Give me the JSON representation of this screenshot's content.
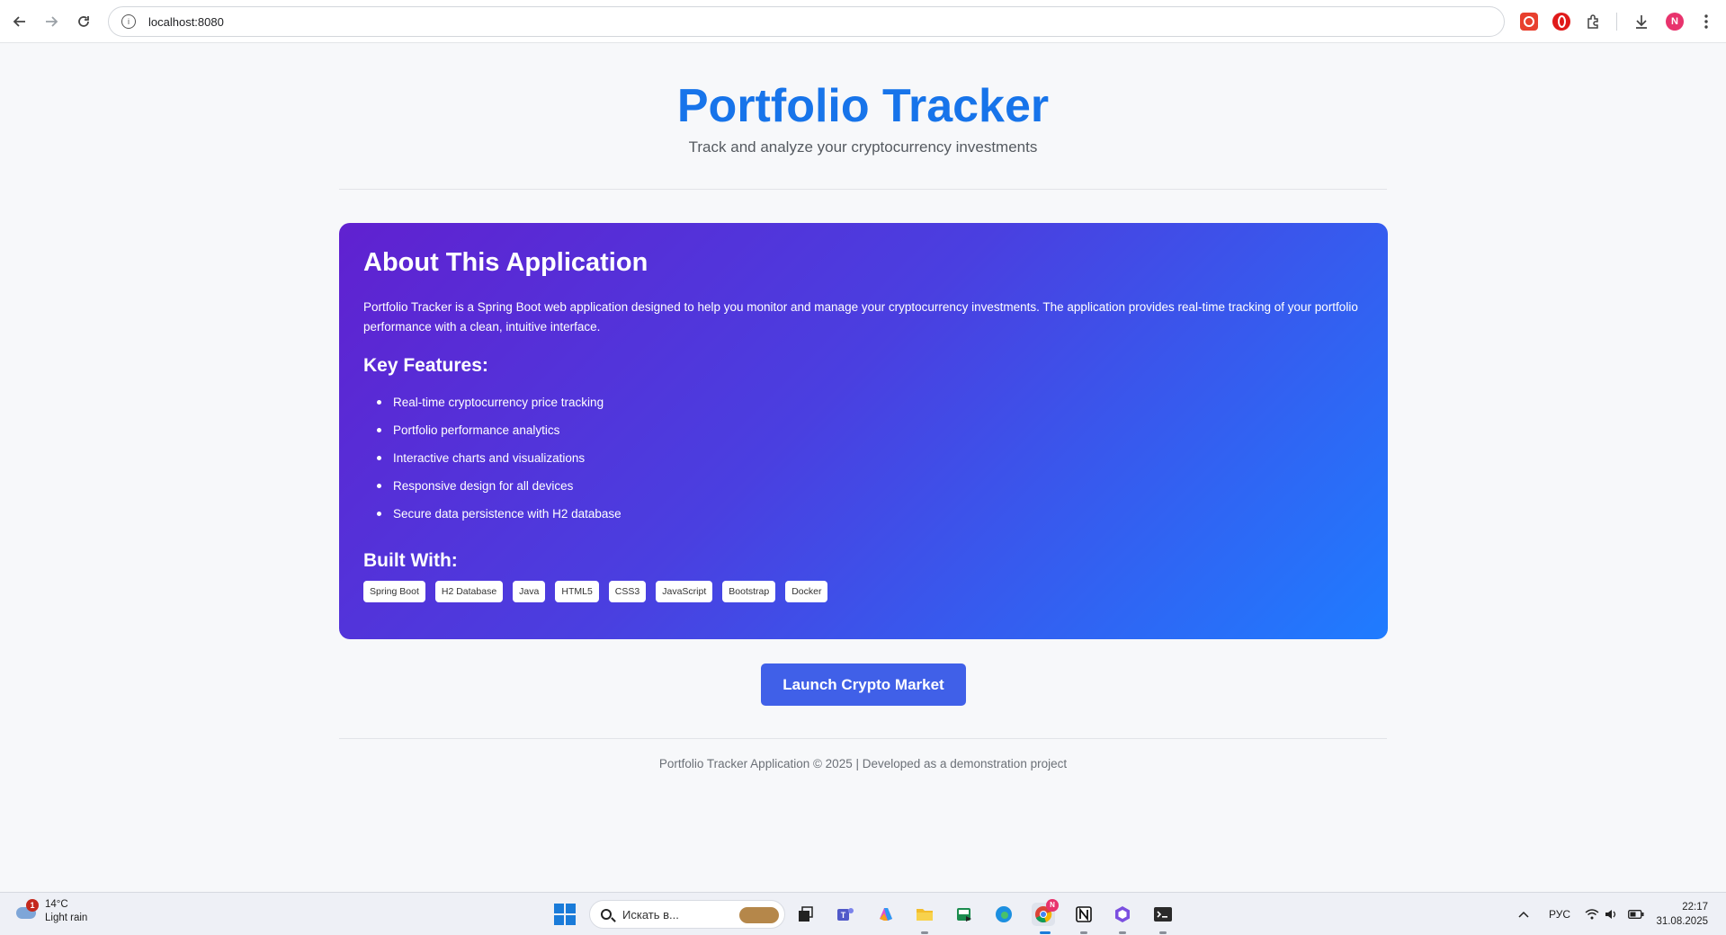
{
  "browser": {
    "url": "localhost:8080",
    "profile_initial": "N",
    "icons": [
      "back-icon",
      "forward-icon",
      "reload-icon",
      "site-info-icon",
      "extension-icon",
      "opera-icon",
      "extensions-puzzle-icon",
      "download-icon",
      "menu-kebab-icon"
    ]
  },
  "header": {
    "title": "Portfolio Tracker",
    "subtitle": "Track and analyze your cryptocurrency investments"
  },
  "about": {
    "heading": "About This Application",
    "description": "Portfolio Tracker is a Spring Boot web application designed to help you monitor and manage your cryptocurrency investments. The application provides real-time tracking of your portfolio performance with a clean, intuitive interface.",
    "features_heading": "Key Features:",
    "features": [
      "Real-time cryptocurrency price tracking",
      "Portfolio performance analytics",
      "Interactive charts and visualizations",
      "Responsive design for all devices",
      "Secure data persistence with H2 database"
    ],
    "built_heading": "Built With:",
    "tags": [
      "Spring Boot",
      "H2 Database",
      "Java",
      "HTML5",
      "CSS3",
      "JavaScript",
      "Bootstrap",
      "Docker"
    ]
  },
  "actions": {
    "launch_label": "Launch Crypto Market"
  },
  "footer": {
    "text": "Portfolio Tracker Application © 2025 | Developed as a demonstration project"
  },
  "colors": {
    "title_blue": "#1774ea",
    "card_gradient_start": "#6021d0",
    "card_gradient_end": "#1f7cff",
    "button": "#4060e8"
  },
  "taskbar": {
    "weather_badge": "1",
    "temperature": "14°C",
    "condition": "Light rain",
    "search_placeholder": "Искать в...",
    "language": "РУС",
    "time": "22:17",
    "date": "31.08.2025",
    "notification_badge": "N"
  }
}
